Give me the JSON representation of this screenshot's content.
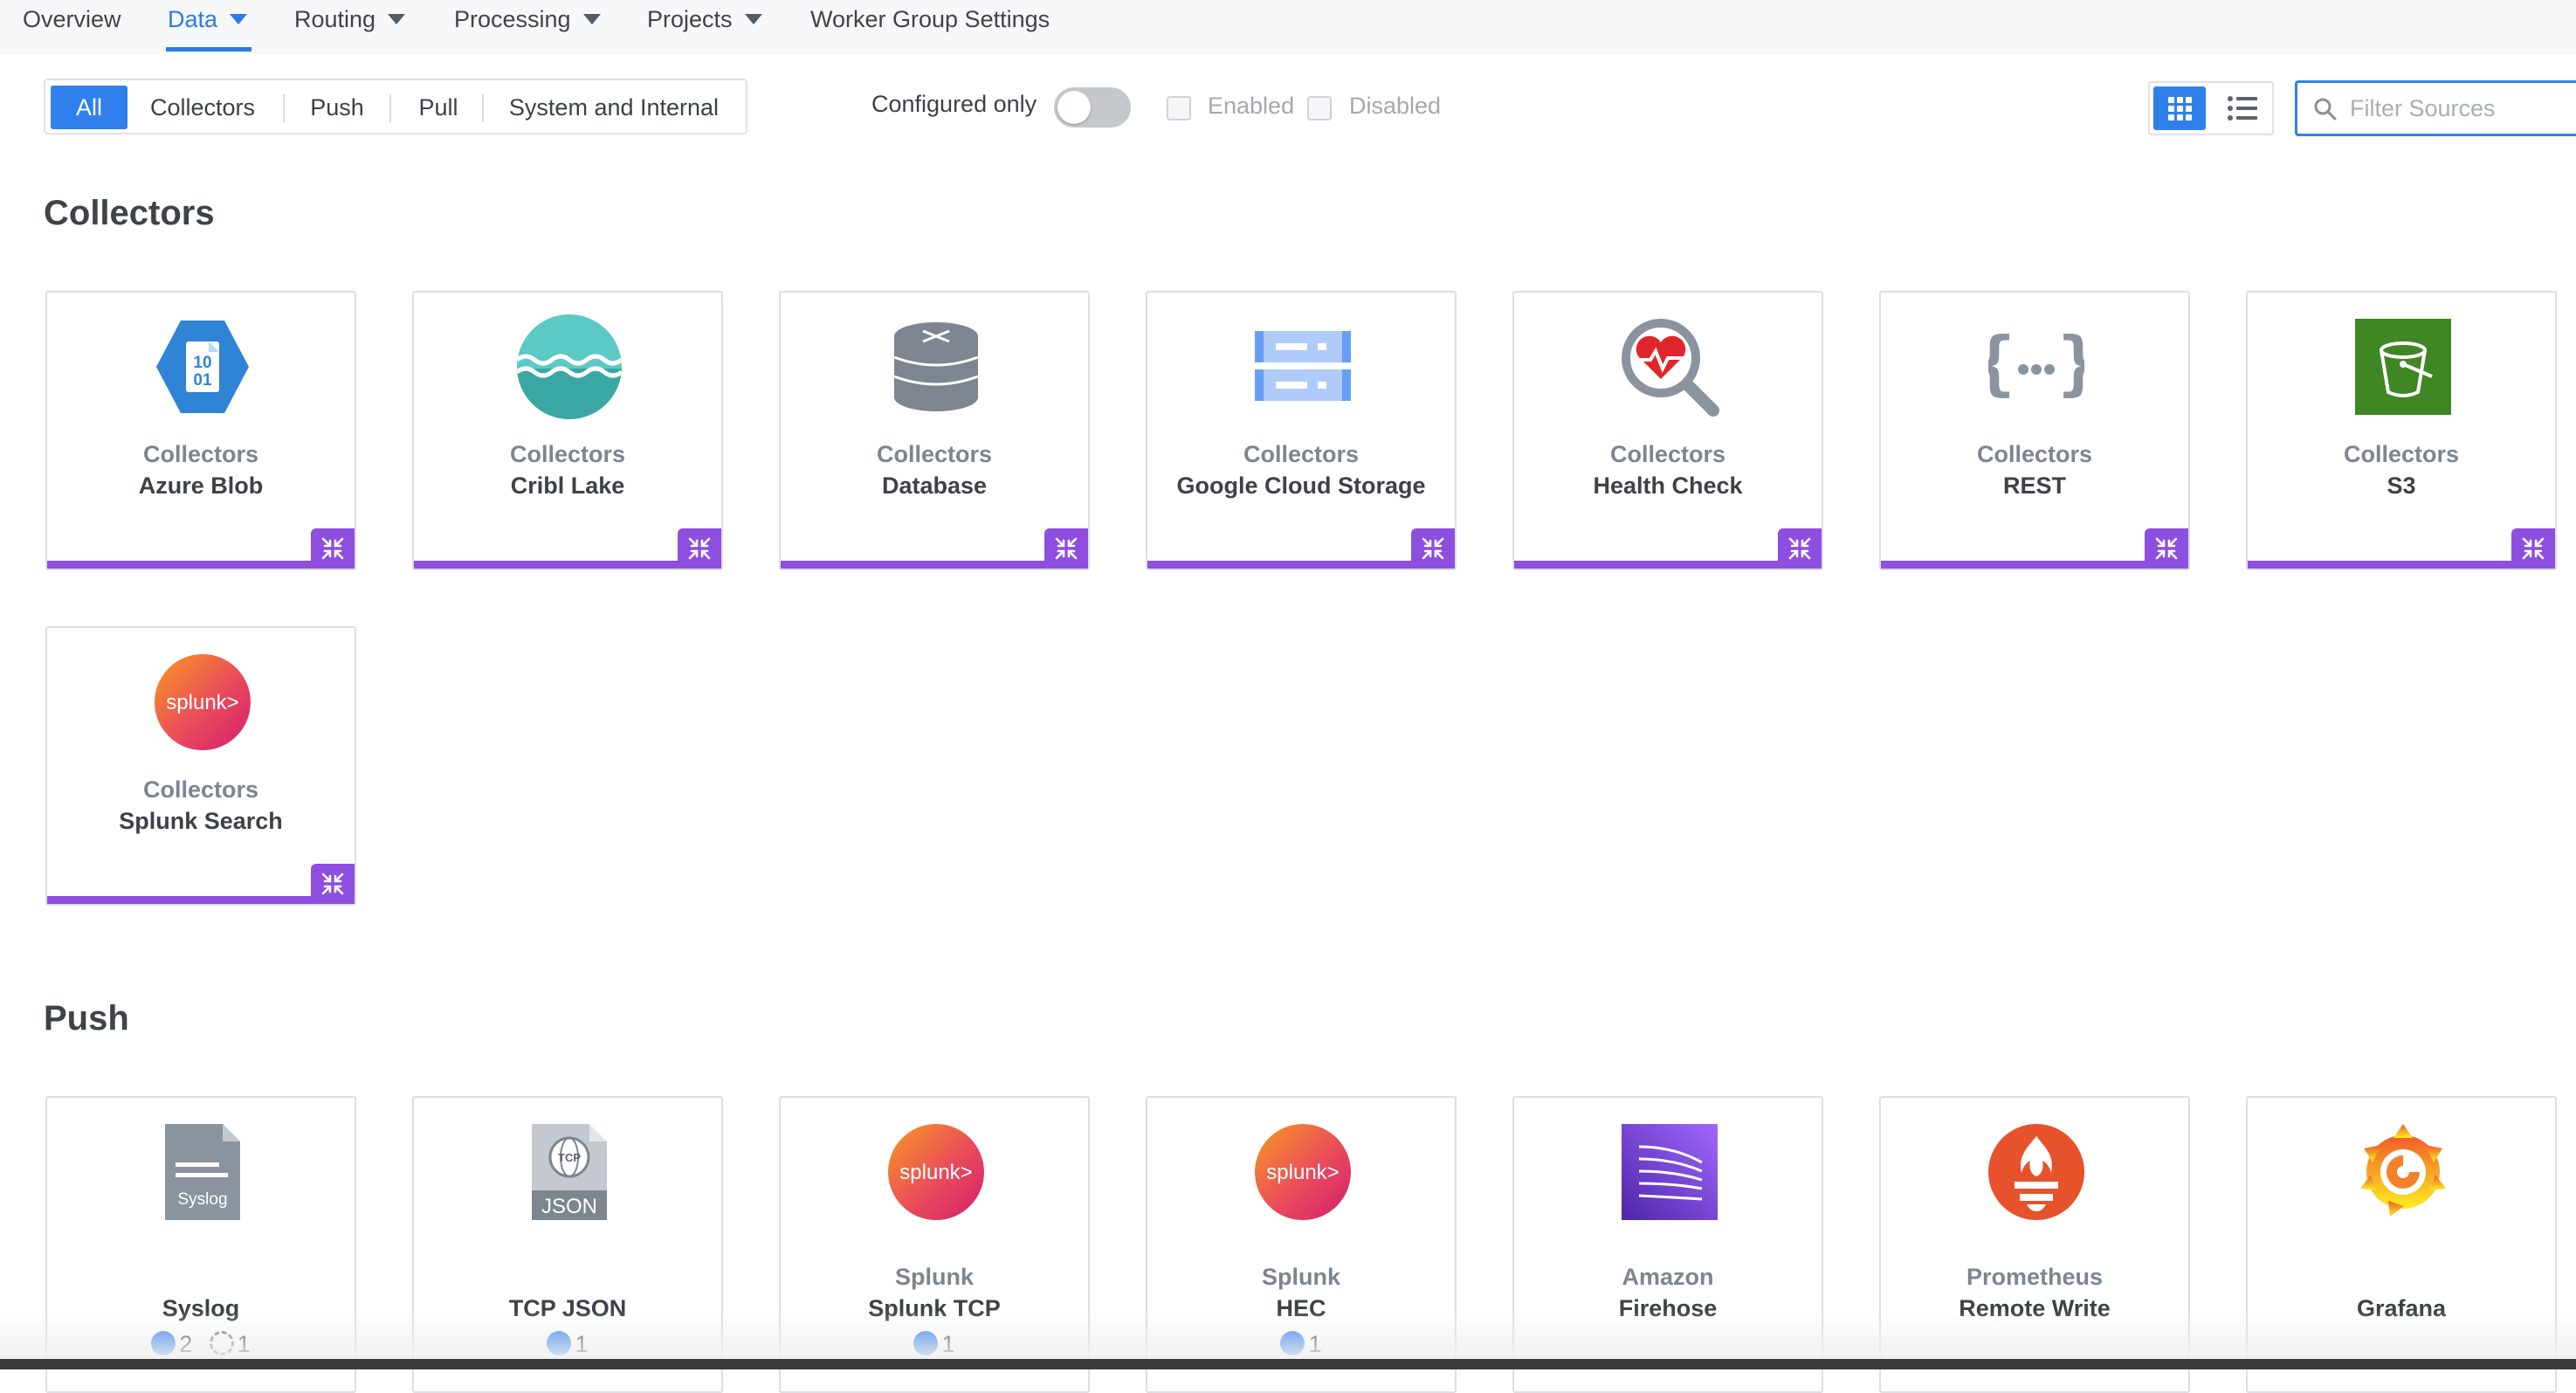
{
  "nav": {
    "items": [
      {
        "label": "Overview",
        "active": false,
        "dropdown": false
      },
      {
        "label": "Data",
        "active": true,
        "dropdown": true
      },
      {
        "label": "Routing",
        "active": false,
        "dropdown": true
      },
      {
        "label": "Processing",
        "active": false,
        "dropdown": true
      },
      {
        "label": "Projects",
        "active": false,
        "dropdown": true
      },
      {
        "label": "Worker Group Settings",
        "active": false,
        "dropdown": false
      }
    ]
  },
  "filters": {
    "segments": [
      "All",
      "Collectors",
      "Push",
      "Pull",
      "System and Internal"
    ],
    "selected_segment": "All",
    "configured_only_label": "Configured only",
    "configured_only": false,
    "enabled_label": "Enabled",
    "disabled_label": "Disabled",
    "enabled_checked": false,
    "disabled_checked": false,
    "view_mode": "grid",
    "search_placeholder": "Filter Sources"
  },
  "sections": {
    "collectors": {
      "title": "Collectors",
      "cards": [
        {
          "category": "Collectors",
          "name": "Azure Blob",
          "icon": "azure-blob-icon"
        },
        {
          "category": "Collectors",
          "name": "Cribl Lake",
          "icon": "cribl-lake-icon"
        },
        {
          "category": "Collectors",
          "name": "Database",
          "icon": "database-icon"
        },
        {
          "category": "Collectors",
          "name": "Google Cloud Storage",
          "icon": "google-cloud-storage-icon"
        },
        {
          "category": "Collectors",
          "name": "Health Check",
          "icon": "health-check-icon"
        },
        {
          "category": "Collectors",
          "name": "REST",
          "icon": "rest-icon"
        },
        {
          "category": "Collectors",
          "name": "S3",
          "icon": "s3-bucket-icon"
        },
        {
          "category": "Collectors",
          "name": "Splunk Search",
          "icon": "splunk-icon"
        }
      ]
    },
    "push": {
      "title": "Push",
      "cards": [
        {
          "category": "",
          "name": "Syslog",
          "icon": "syslog-icon",
          "enabled_count": "2",
          "disabled_count": "1"
        },
        {
          "category": "",
          "name": "TCP JSON",
          "icon": "tcp-json-icon",
          "enabled_count": "1"
        },
        {
          "category": "Splunk",
          "name": "Splunk TCP",
          "icon": "splunk-icon",
          "enabled_count": "1"
        },
        {
          "category": "Splunk",
          "name": "HEC",
          "icon": "splunk-icon",
          "enabled_count": "1"
        },
        {
          "category": "Amazon",
          "name": "Firehose",
          "icon": "amazon-firehose-icon"
        },
        {
          "category": "Prometheus",
          "name": "Remote Write",
          "icon": "prometheus-icon"
        },
        {
          "category": "",
          "name": "Grafana",
          "icon": "grafana-icon"
        }
      ]
    }
  },
  "splunk_logo_text": "splunk>",
  "azure_logo_text": "10 01",
  "syslog_logo_text": "Syslog",
  "tcp_logo_text": "TCP",
  "json_logo_text": "JSON",
  "colors": {
    "accent": "#2f80ed",
    "collector_bar": "#8e4ee0"
  }
}
